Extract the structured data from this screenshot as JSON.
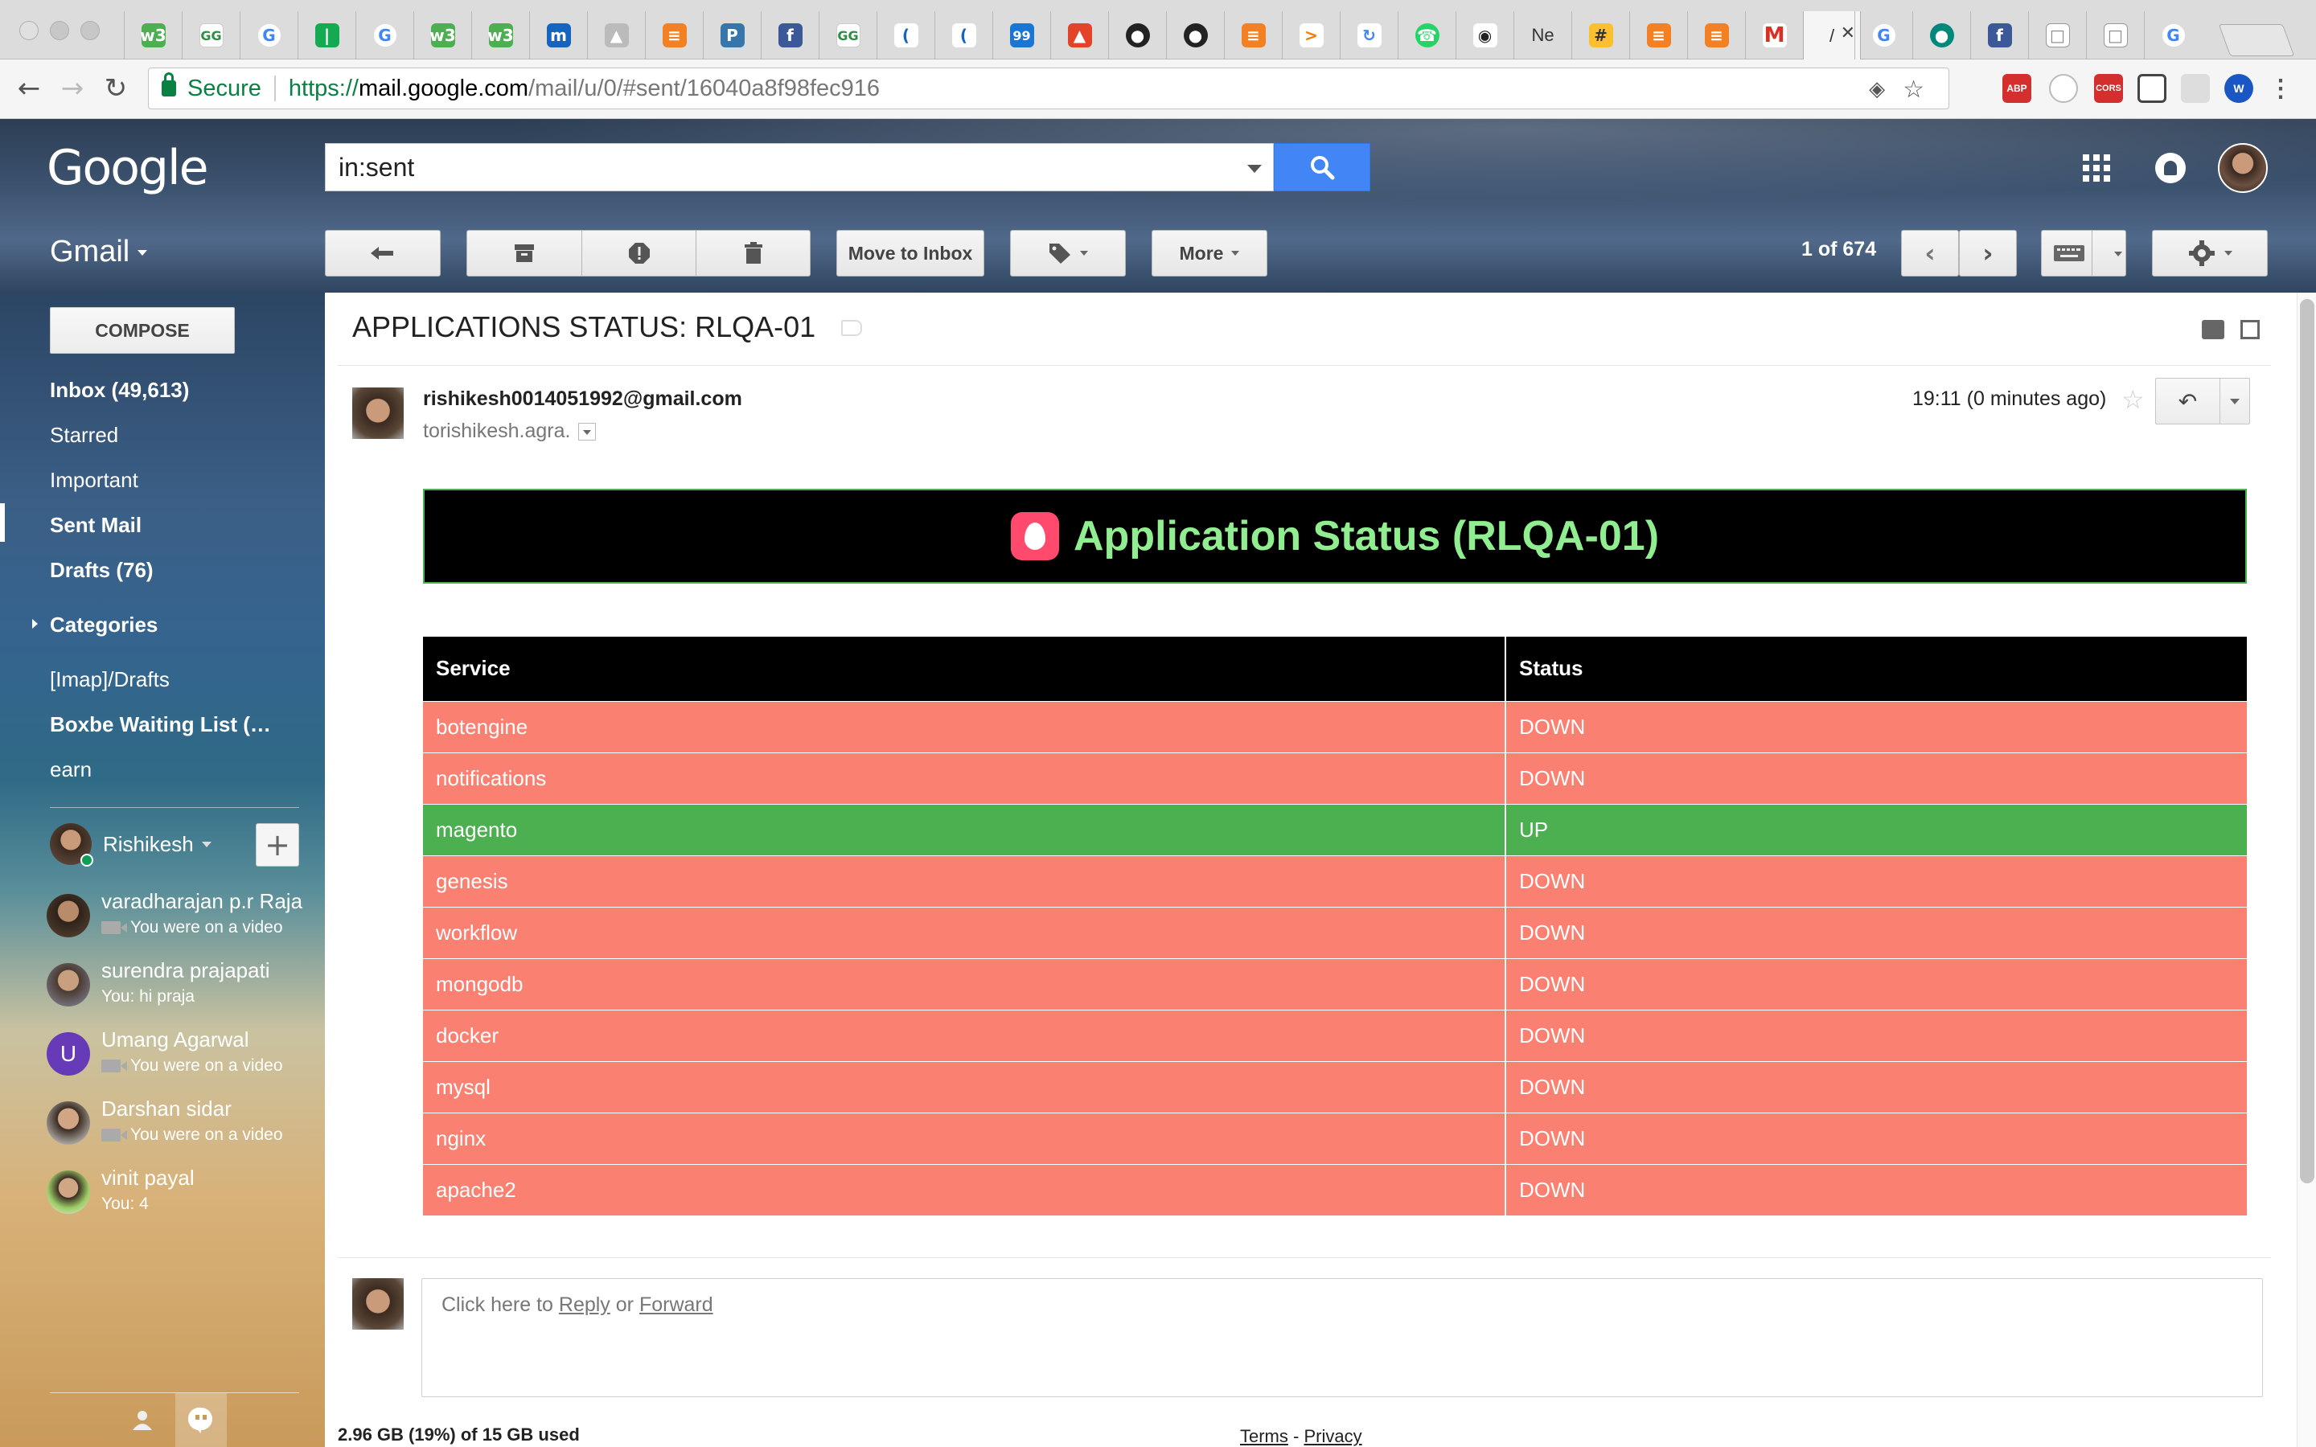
{
  "browser": {
    "secure_label": "Secure",
    "url_scheme": "https://",
    "url_host": "mail.google.com",
    "url_path": "/mail/u/0/#sent/16040a8f98fec916",
    "tab_text_ne": "Ne",
    "active_tab_text": "‎",
    "colors": {
      "secure_green": "#0b8043"
    }
  },
  "header": {
    "logo_text": "Google",
    "search_value": "in:sent",
    "product_label": "Gmail",
    "counter": "1 of 674",
    "move_to_inbox_label": "Move to Inbox",
    "more_label": "More",
    "search_button_color": "#4285f4"
  },
  "sidebar": {
    "compose_label": "COMPOSE",
    "items": [
      {
        "label": "Inbox (49,613)"
      },
      {
        "label": "Starred"
      },
      {
        "label": "Important"
      },
      {
        "label": "Sent Mail"
      },
      {
        "label": "Drafts (76)"
      },
      {
        "label": "Categories"
      },
      {
        "label": "[Imap]/Drafts"
      },
      {
        "label": "Boxbe Waiting List (…"
      },
      {
        "label": "earn"
      }
    ],
    "hangouts_self": "Rishikesh",
    "contacts": [
      {
        "name": "varadharajan p.r Raja",
        "status": "You were on a video"
      },
      {
        "name": "surendra prajapati",
        "status": "You: hi praja"
      },
      {
        "name": "Umang Agarwal",
        "status": "You were on a video",
        "initial": "U"
      },
      {
        "name": "Darshan sidar",
        "status": "You were on a video"
      },
      {
        "name": "vinit payal",
        "status": "You: 4"
      }
    ]
  },
  "message": {
    "subject": "APPLICATIONS STATUS: RLQA-01",
    "sender": "rishikesh0014051992@gmail.com",
    "to_prefix": "to ",
    "to_name": "rishikesh.agra.",
    "time": "19:11 (0 minutes ago)",
    "banner_title": "Application Status (RLQA-01)",
    "table": {
      "headers": [
        "Service",
        "Status"
      ],
      "rows": [
        {
          "service": "botengine",
          "status": "DOWN",
          "color": "#fa8072"
        },
        {
          "service": "notifications",
          "status": "DOWN",
          "color": "#fa8072"
        },
        {
          "service": "magento",
          "status": "UP",
          "color": "#4caf50"
        },
        {
          "service": "genesis",
          "status": "DOWN",
          "color": "#fa8072"
        },
        {
          "service": "workflow",
          "status": "DOWN",
          "color": "#fa8072"
        },
        {
          "service": "mongodb",
          "status": "DOWN",
          "color": "#fa8072"
        },
        {
          "service": "docker",
          "status": "DOWN",
          "color": "#fa8072"
        },
        {
          "service": "mysql",
          "status": "DOWN",
          "color": "#fa8072"
        },
        {
          "service": "nginx",
          "status": "DOWN",
          "color": "#fa8072"
        },
        {
          "service": "apache2",
          "status": "DOWN",
          "color": "#fa8072"
        }
      ]
    }
  },
  "reply": {
    "prefix": "Click here to ",
    "reply_link": "Reply",
    "or_text": " or ",
    "forward_link": "Forward"
  },
  "footer": {
    "usage": "2.96 GB (19%) of 15 GB used",
    "terms": "Terms",
    "dash": " - ",
    "privacy": "Privacy"
  }
}
